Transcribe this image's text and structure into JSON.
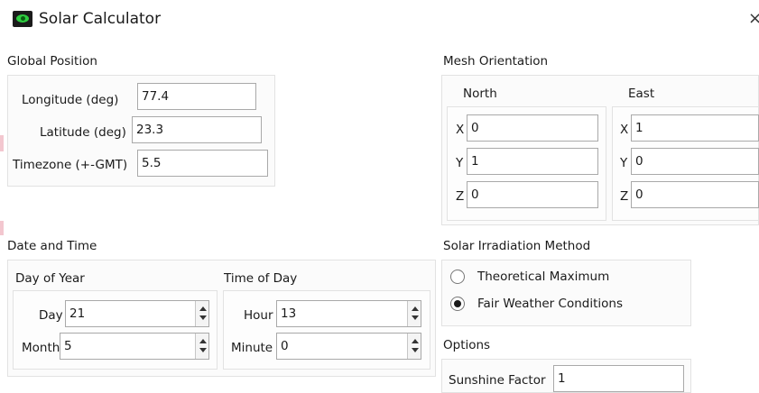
{
  "window": {
    "title": "Solar Calculator",
    "close_glyph": "×"
  },
  "global_position": {
    "label": "Global Position",
    "longitude": {
      "label": "Longitude (deg)",
      "value": "77.4"
    },
    "latitude": {
      "label": "Latitude (deg)",
      "value": "23.3"
    },
    "timezone": {
      "label": "Timezone (+-GMT)",
      "value": "5.5"
    }
  },
  "mesh_orientation": {
    "label": "Mesh Orientation",
    "north": {
      "label": "North",
      "x_label": "X",
      "x": "0",
      "y_label": "Y",
      "y": "1",
      "z_label": "Z",
      "z": "0"
    },
    "east": {
      "label": "East",
      "x_label": "X",
      "x": "1",
      "y_label": "Y",
      "y": "0",
      "z_label": "Z",
      "z": "0"
    }
  },
  "date_time": {
    "label": "Date and Time",
    "day_of_year": {
      "label": "Day of Year",
      "day": {
        "label": "Day",
        "value": "21"
      },
      "month": {
        "label": "Month",
        "value": "5"
      }
    },
    "time_of_day": {
      "label": "Time of Day",
      "hour": {
        "label": "Hour",
        "value": "13"
      },
      "minute": {
        "label": "Minute",
        "value": "0"
      }
    }
  },
  "irradiation": {
    "label": "Solar Irradiation Method",
    "options": [
      {
        "label": "Theoretical Maximum",
        "selected": false
      },
      {
        "label": "Fair Weather Conditions",
        "selected": true
      }
    ]
  },
  "options": {
    "label": "Options",
    "sunshine_factor": {
      "label": "Sunshine Factor",
      "value": "1"
    }
  }
}
